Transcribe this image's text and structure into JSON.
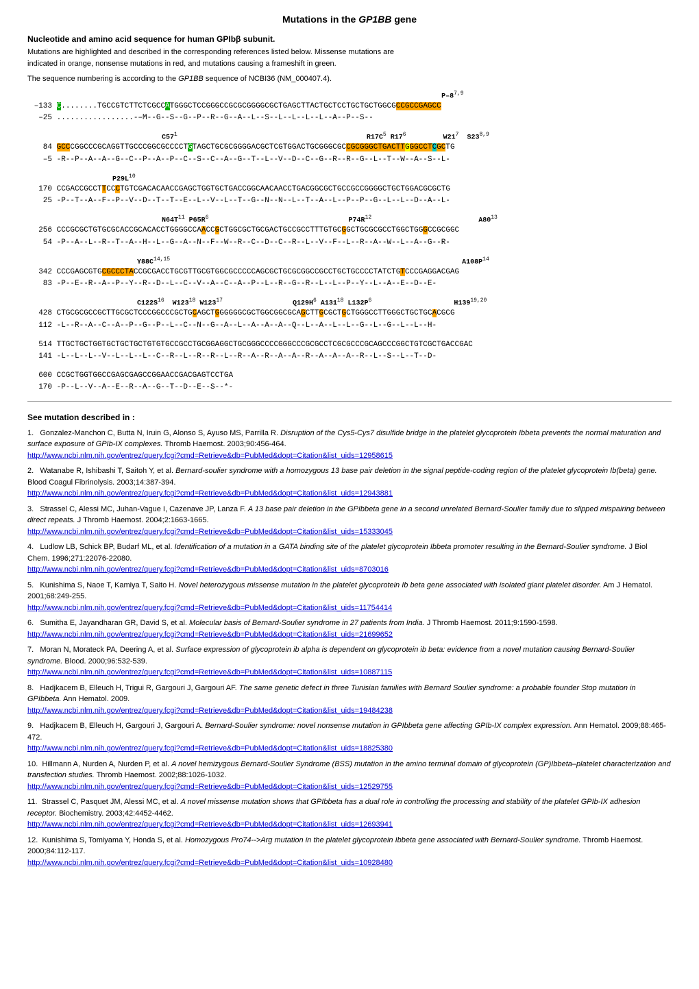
{
  "page": {
    "title": "Mutations in the GP1BB gene",
    "subtitle": "Nucleotide and amino acid sequence for human GPIbβ subunit.",
    "description1": "Mutations are highlighted and described in the corresponding references listed below. Missense mutations are indicated in orange, nonsense mutations in red, and mutations causing a frameshift in green.",
    "description2": "The sequence numbering is according to the GP1BB sequence of NCBI36 (NM_000407.4).",
    "see_mutation_label": "See mutation described in :"
  },
  "references": [
    {
      "num": "1",
      "text": "Gonzalez-Manchon C, Butta N, Iruin G, Alonso S, Ayuso MS, Parrilla R. Disruption of the Cys5-Cys7 disulfide bridge in the platelet glycoprotein Ibbeta prevents the normal maturation and surface exposure of GPIb-IX complexes. Thromb Haemost. 2003;90:456-464.",
      "link": "http://www.ncbi.nlm.nih.gov/entrez/query.fcgi?cmd=Retrieve&db=PubMed&dopt=Citation&list_uids=12958615"
    },
    {
      "num": "2",
      "text": "Watanabe R, Ishibashi T, Saitoh Y, et al. Bernard-soulier syndrome with a homozygous 13 base pair deletion in the signal peptide-coding region of the platelet glycoprotein Ib(beta) gene. Blood Coagul Fibrinolysis. 2003;14:387-394.",
      "link": "http://www.ncbi.nlm.nih.gov/entrez/query.fcgi?cmd=Retrieve&db=PubMed&dopt=Citation&list_uids=12943881"
    },
    {
      "num": "3",
      "text": "Strassel C, Alessi MC, Juhan-Vague I, Cazenave JP, Lanza F. A 13 base pair deletion in the GPIbbeta gene in a second unrelated Bernard-Soulier family due to slipped mispairing between direct repeats. J Thromb Haemost. 2004;2:1663-1665.",
      "link": "http://www.ncbi.nlm.nih.gov/entrez/query.fcgi?cmd=Retrieve&db=PubMed&dopt=Citation&list_uids=15333045"
    },
    {
      "num": "4",
      "text": "Ludlow LB, Schick BP, Budarf ML, et al. Identification of a mutation in a GATA binding site of the platelet glycoprotein Ibbeta promoter resulting in the Bernard-Soulier syndrome. J Biol Chem. 1996;271:22076-22080.",
      "link": "http://www.ncbi.nlm.nih.gov/entrez/query.fcgi?cmd=Retrieve&db=PubMed&dopt=Citation&list_uids=8703016"
    },
    {
      "num": "5",
      "text": "Kunishima S, Naoe T, Kamiya T, Saito H. Novel heterozygous missense mutation in the platelet glycoprotein Ib beta gene associated with isolated giant platelet disorder. Am J Hematol. 2001;68:249-255.",
      "link": "http://www.ncbi.nlm.nih.gov/entrez/query.fcgi?cmd=Retrieve&db=PubMed&dopt=Citation&list_uids=11754414"
    },
    {
      "num": "6",
      "text": "Sumitha E, Jayandharan GR, David S, et al. Molecular basis of Bernard-Soulier syndrome in 27 patients from India. J Thromb Haemost. 2011;9:1590-1598.",
      "link": "http://www.ncbi.nlm.nih.gov/entrez/query.fcgi?cmd=Retrieve&db=PubMed&dopt=Citation&list_uids=21699652"
    },
    {
      "num": "7",
      "text": "Moran N, Morateck PA, Deering A, et al. Surface expression of glycoprotein ib alpha is dependent on glycoprotein ib beta: evidence from a novel mutation causing Bernard-Soulier syndrome. Blood. 2000;96:532-539.",
      "link": "http://www.ncbi.nlm.nih.gov/entrez/query.fcgi?cmd=Retrieve&db=PubMed&dopt=Citation&list_uids=10887115"
    },
    {
      "num": "8",
      "text": "Hadjkacem B, Elleuch H, Trigui R, Gargouri J, Gargouri AF. The same genetic defect in three Tunisian families with Bernard Soulier syndrome: a probable founder Stop mutation in GPIbbeta. Ann Hematol. 2009.",
      "link": "http://www.ncbi.nlm.nih.gov/entrez/query.fcgi?cmd=Retrieve&db=PubMed&dopt=Citation&list_uids=19484238"
    },
    {
      "num": "9",
      "text": "Hadjkacem B, Elleuch H, Gargouri J, Gargouri A. Bernard-Soulier syndrome: novel nonsense mutation in GPIbbeta gene affecting GPIb-IX complex expression. Ann Hematol. 2009;88:465-472.",
      "link": "http://www.ncbi.nlm.nih.gov/entrez/query.fcgi?cmd=Retrieve&db=PubMed&dopt=Citation&list_uids=18825380"
    },
    {
      "num": "10",
      "text": "Hillmann A, Nurden A, Nurden P, et al. A novel hemizygous Bernard-Soulier Syndrome (BSS) mutation in the amino terminal domain of glycoprotein (GP)Ibbeta–platelet characterization and transfection studies. Thromb Haemost. 2002;88:1026-1032.",
      "link": "http://www.ncbi.nlm.nih.gov/entrez/query.fcgi?cmd=Retrieve&db=PubMed&dopt=Citation&list_uids=12529755"
    },
    {
      "num": "11",
      "text": "Strassel C, Pasquet JM, Alessi MC, et al. A novel missense mutation shows that GPIbbeta has a dual role in controlling the processing and stability of the platelet GPIb-IX adhesion receptor. Biochemistry. 2003;42:4452-4462.",
      "link": "http://www.ncbi.nlm.nih.gov/entrez/query.fcgi?cmd=Retrieve&db=PubMed&dopt=Citation&list_uids=12693941"
    },
    {
      "num": "12",
      "text": "Kunishima S, Tomiyama Y, Honda S, et al. Homozygous Pro74-->Arg mutation in the platelet glycoprotein Ibbeta gene associated with Bernard-Soulier syndrome. Thromb Haemost. 2000;84:112-117.",
      "link": "http://www.ncbi.nlm.nih.gov/entrez/query.fcgi?cmd=Retrieve&db=PubMed&dopt=Citation&list_uids=10928480"
    }
  ]
}
